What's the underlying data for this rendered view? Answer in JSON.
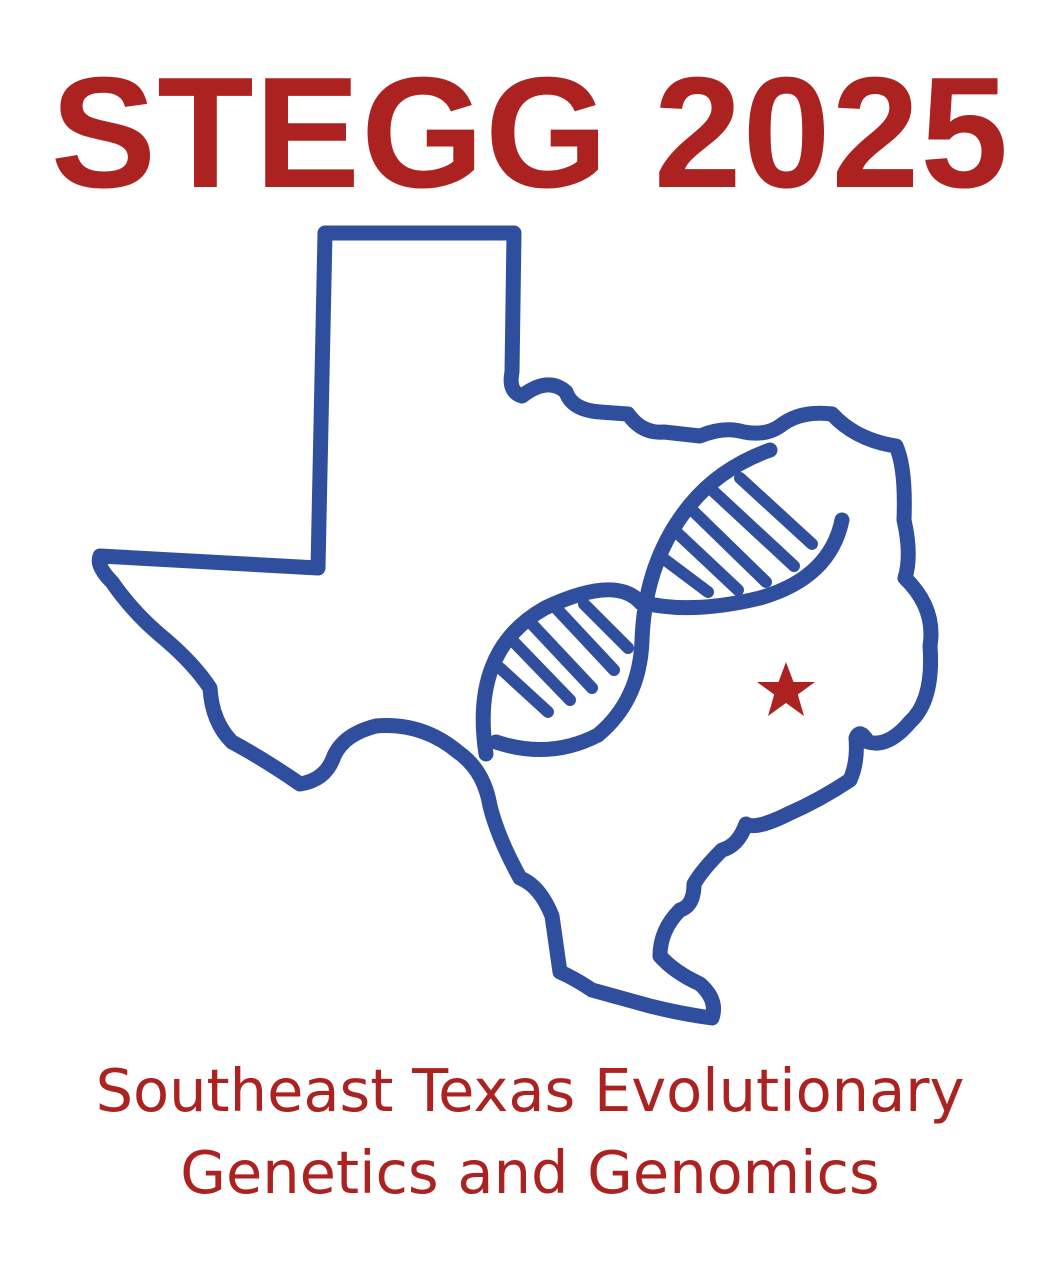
{
  "logo": {
    "title": "STEGG 2025",
    "subtitle_line1": "Southeast Texas Evolutionary",
    "subtitle_line2": "Genetics and Genomics"
  },
  "colors": {
    "title_red": "#ac2220",
    "outline_blue": "#2f4f9e",
    "star_red": "#ac2220",
    "background": "#ffffff"
  },
  "icons": [
    "texas-outline-icon",
    "dna-helix-icon",
    "star-icon"
  ]
}
